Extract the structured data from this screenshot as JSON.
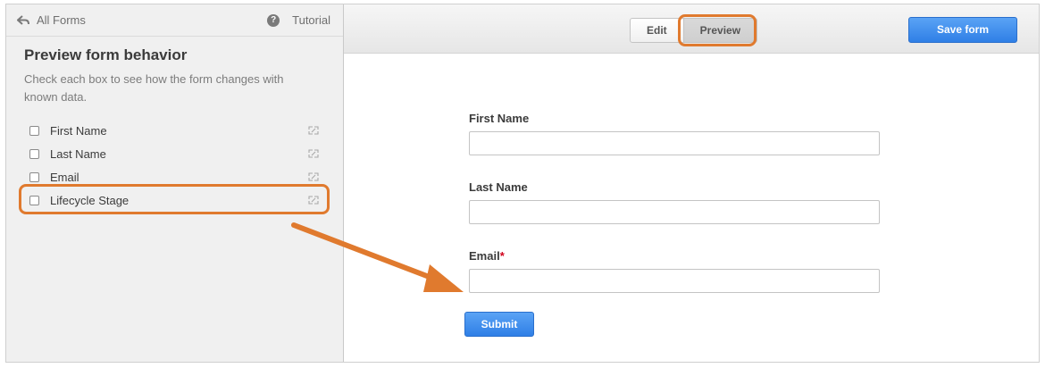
{
  "sidebar": {
    "back_label": "All Forms",
    "tutorial_label": "Tutorial",
    "help_glyph": "?",
    "title": "Preview form behavior",
    "description": "Check each box to see how the form changes with known data.",
    "fields": [
      {
        "label": "First Name",
        "checked": false
      },
      {
        "label": "Last Name",
        "checked": false
      },
      {
        "label": "Email",
        "checked": false
      },
      {
        "label": "Lifecycle Stage",
        "checked": false
      }
    ]
  },
  "toolbar": {
    "edit_label": "Edit",
    "preview_label": "Preview",
    "save_label": "Save form"
  },
  "form": {
    "fields": [
      {
        "label": "First Name",
        "required": false,
        "value": ""
      },
      {
        "label": "Last Name",
        "required": false,
        "value": ""
      },
      {
        "label": "Email",
        "required": true,
        "required_mark": "*",
        "value": ""
      }
    ],
    "submit_label": "Submit"
  },
  "colors": {
    "annotation": "#e07a2e",
    "primary_button": "#2f7fe6",
    "required": "#d0021b"
  },
  "icons": [
    "back-arrow-icon",
    "help-icon",
    "link-icon",
    "annotation-arrow"
  ]
}
